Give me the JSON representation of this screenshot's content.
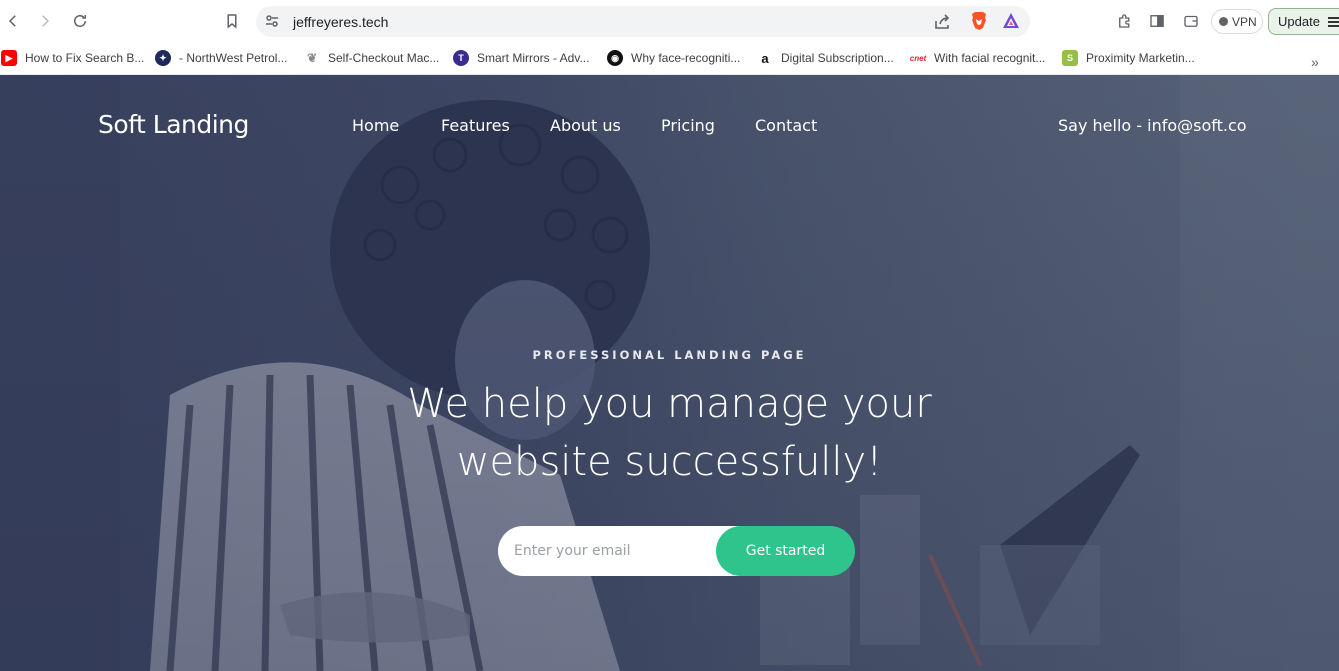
{
  "browser": {
    "url": "jeffreyeres.tech",
    "vpn_label": "VPN",
    "update_label": "Update",
    "bookmarks": [
      {
        "label": "How to Fix Search B...",
        "icon": "youtube-icon",
        "color": "#ff0000"
      },
      {
        "label": "- NorthWest Petrol...",
        "icon": "northwest-icon",
        "color": "#1f2a5c"
      },
      {
        "label": "Self-Checkout Mac...",
        "icon": "leaf-icon",
        "color": "#8a8a8a"
      },
      {
        "label": "Smart Mirrors - Adv...",
        "icon": "t-logo-icon",
        "color": "#3b2b8f"
      },
      {
        "label": "Why face-recogniti...",
        "icon": "eye-icon",
        "color": "#111111"
      },
      {
        "label": "Digital Subscription...",
        "icon": "amazon-icon",
        "color": "#ff9900"
      },
      {
        "label": "With facial recognit...",
        "icon": "cnet-icon",
        "color": "#d6262e"
      },
      {
        "label": "Proximity Marketin...",
        "icon": "shopify-icon",
        "color": "#95bf47"
      }
    ]
  },
  "site": {
    "logo": "Soft Landing",
    "nav": [
      "Home",
      "Features",
      "About us",
      "Pricing",
      "Contact"
    ],
    "contact": "Say hello - info@soft.co",
    "kicker": "PROFESSIONAL LANDING PAGE",
    "headline_line1": "We help you manage your",
    "headline_line2": "website successfully!",
    "email_placeholder": "Enter your email",
    "cta_label": "Get started",
    "accent_color": "#2ec48c"
  }
}
